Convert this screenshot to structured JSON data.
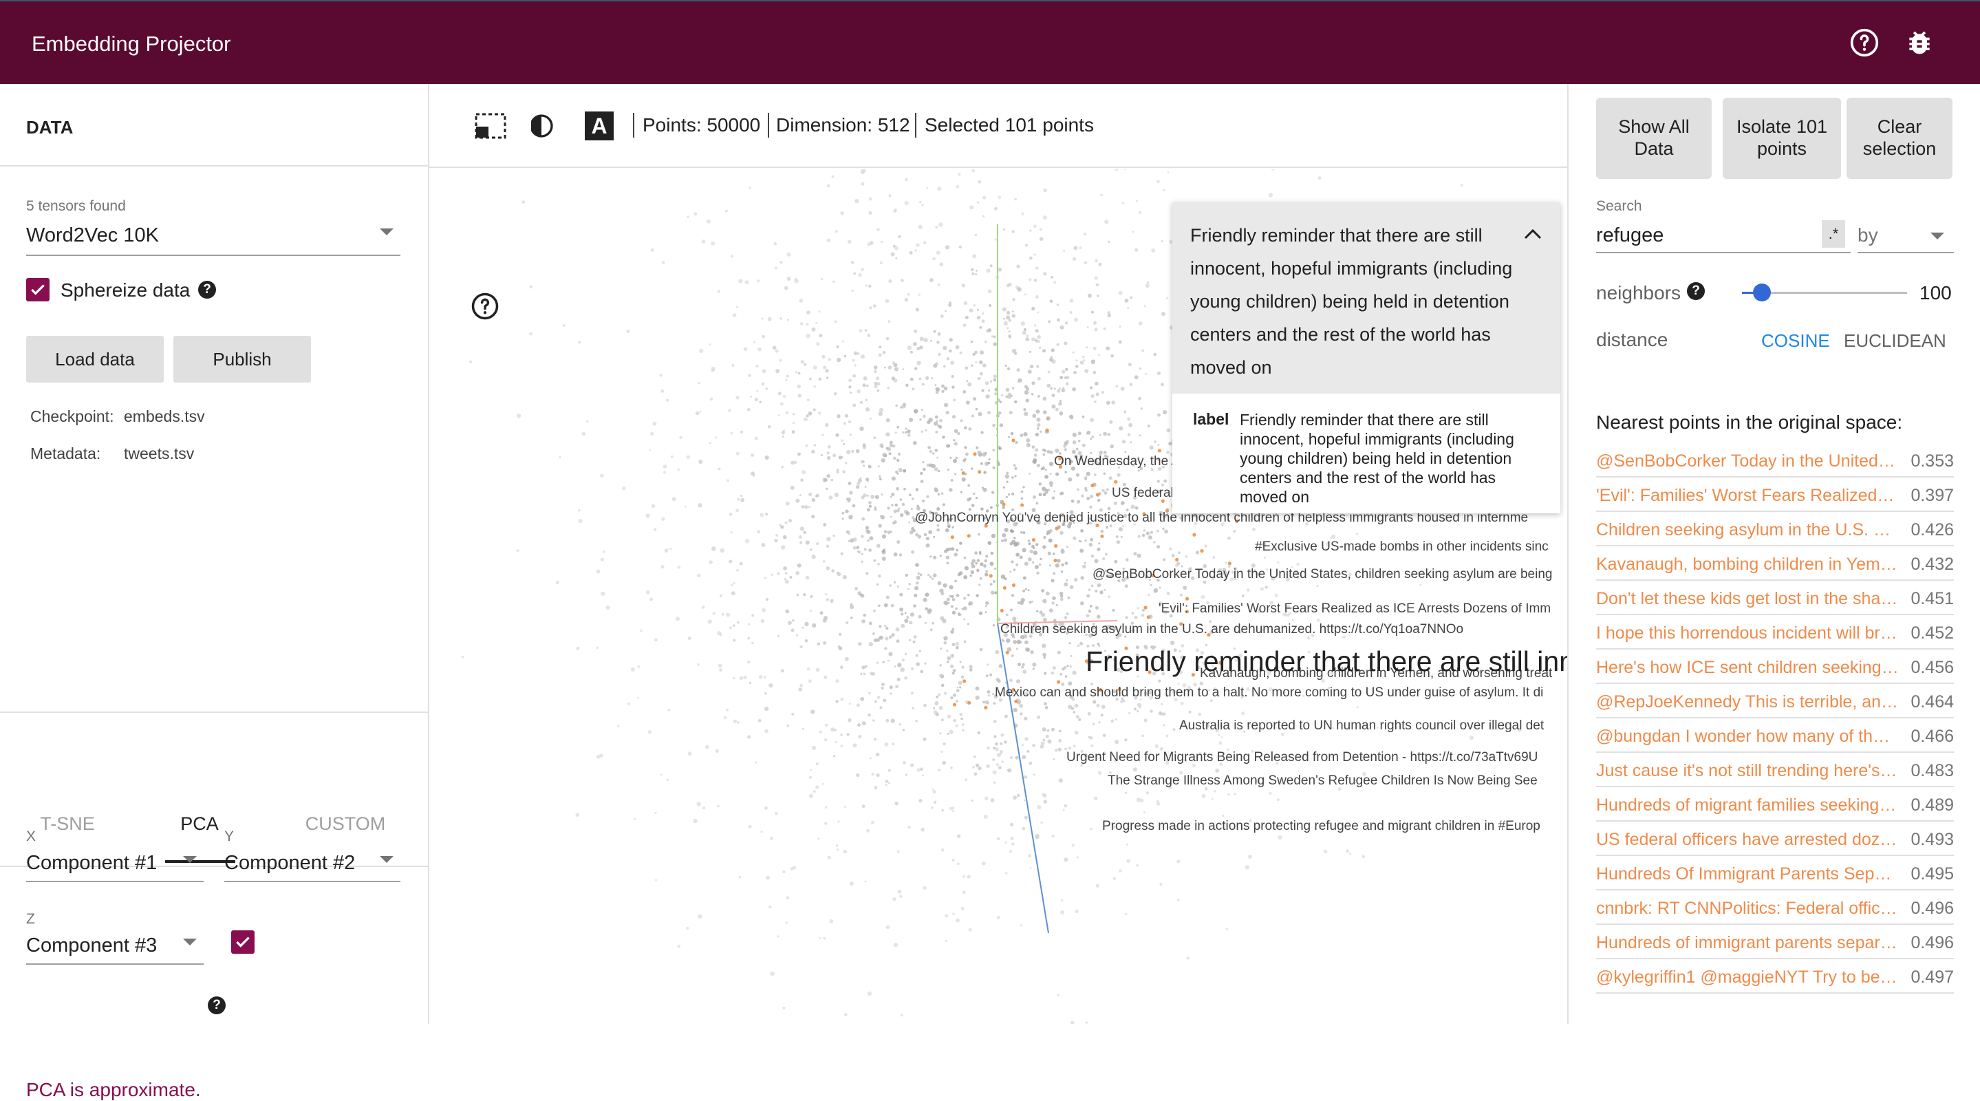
{
  "header": {
    "title": "Embedding Projector"
  },
  "left": {
    "section_title": "DATA",
    "tensors_found": "5 tensors found",
    "tensor_selected": "Word2Vec 10K",
    "sphereize_label": "Sphereize data",
    "load_button": "Load data",
    "publish_button": "Publish",
    "checkpoint_key": "Checkpoint:",
    "checkpoint_val": "embeds.tsv",
    "metadata_key": "Metadata:",
    "metadata_val": "tweets.tsv",
    "tabs": [
      "T-SNE",
      "PCA",
      "CUSTOM"
    ],
    "x_label": "X",
    "x_value": "Component #1",
    "y_label": "Y",
    "y_value": "Component #2",
    "z_label": "Z",
    "z_value": "Component #3",
    "pca_warning": "PCA is approximate."
  },
  "toolbar": {
    "points": "Points: 50000",
    "dimension": "Dimension: 512",
    "selected": "Selected 101 points"
  },
  "card": {
    "title": "Friendly reminder that there are still innocent, hopeful immigrants (including young children) being held in detention centers and the rest of the world has moved on",
    "label_key": "label",
    "label_value": "Friendly reminder that there are still innocent, hopeful immigrants (including young children) being held in detention centers and the rest of the world has moved on"
  },
  "canvas": {
    "big_label": "Friendly reminder that there are still inno",
    "point_labels": [
      "On Wednesday, the ACLU re",
      "US federal officers have arrested dozens of immigrants who came forward",
      "@JohnCornyn You've denied justice to all the innocent children of helpless immigrants housed in internme",
      "#Exclusive US-made bombs in other incidents sinc",
      "@SenBobCorker Today in the United States, children seeking asylum are being",
      "'Evil': Families' Worst Fears Realized as ICE Arrests Dozens of Imm",
      "Children seeking asylum in the U.S. are dehumanized. https://t.co/Yq1oa7NNOo",
      "Kavanaugh, bombing children in Yemen, and worsening treat",
      "Mexico can and should bring them to a halt. No more coming to US under guise of asylum. It di",
      "Australia is reported to UN human rights council over illegal det",
      "Urgent Need for Migrants Being Released from Detention - https://t.co/73aTtv69U",
      "The Strange Illness Among Sweden's Refugee Children Is Now Being See",
      "Progress made in actions protecting refugee and migrant children in #Europ"
    ]
  },
  "right": {
    "show_all": "Show All Data",
    "isolate": "Isolate 101 points",
    "clear": "Clear selection",
    "search_label": "Search",
    "search_value": "refugee",
    "regex": ".*",
    "by_placeholder": "by",
    "neighbors_label": "neighbors",
    "neighbors_value": "100",
    "distance_label": "distance",
    "cosine": "COSINE",
    "euclidean": "EUCLIDEAN",
    "nearest_title": "Nearest points in the original space:",
    "nearest": [
      {
        "text": "@SenBobCorker Today in the United Sta...",
        "value": "0.353"
      },
      {
        "text": "'Evil': Families' Worst Fears Realized as I...",
        "value": "0.397"
      },
      {
        "text": "Children seeking asylum in the U.S. are ...",
        "value": "0.426"
      },
      {
        "text": "Kavanaugh, bombing children in Yemen,...",
        "value": "0.432"
      },
      {
        "text": "Don't let these kids get lost in the sham...",
        "value": "0.451"
      },
      {
        "text": "I hope this horrendous incident will brin...",
        "value": "0.452"
      },
      {
        "text": "Here's how ICE sent children seeking as...",
        "value": "0.456"
      },
      {
        "text": "@RepJoeKennedy This is terrible, and s...",
        "value": "0.464"
      },
      {
        "text": "@bungdan I wonder how many of the ch...",
        "value": "0.466"
      },
      {
        "text": "Just cause it's not still trending here's a ...",
        "value": "0.483"
      },
      {
        "text": "Hundreds of migrant families seeking a...",
        "value": "0.489"
      },
      {
        "text": "US federal officers have arrested dozens...",
        "value": "0.493"
      },
      {
        "text": "Hundreds Of Immigrant Parents Separat...",
        "value": "0.495"
      },
      {
        "text": "cnnbrk: RT CNNPolitics: Federal officers...",
        "value": "0.496"
      },
      {
        "text": "Hundreds of immigrant parents separat...",
        "value": "0.496"
      },
      {
        "text": "@kylegriffin1 @maggieNYT Try to be a r...",
        "value": "0.497"
      }
    ]
  }
}
